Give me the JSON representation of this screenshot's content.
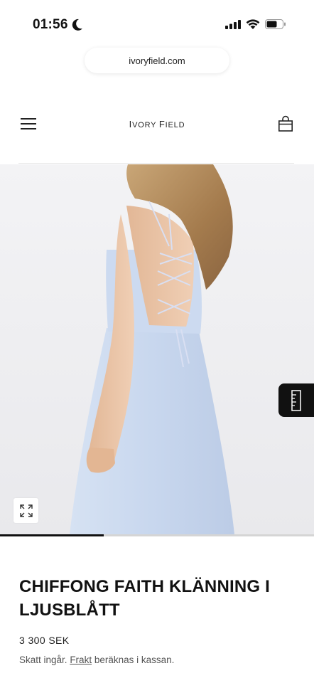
{
  "status_bar": {
    "time": "01:56",
    "icons": [
      "moon-icon",
      "signal-icon",
      "wifi-icon",
      "battery-icon"
    ]
  },
  "browser": {
    "url": "ivoryfield.com"
  },
  "header": {
    "brand_first_letter_1": "I",
    "brand_rest_1": "vory",
    "brand_first_letter_2": "F",
    "brand_rest_2": "ield",
    "icons": [
      "hamburger-menu-icon",
      "shopping-bag-icon"
    ]
  },
  "gallery": {
    "image_description": "product-photo",
    "expand_icon": "expand-icon",
    "size_guide_icon": "ruler-icon",
    "progress_fraction": 0.33
  },
  "product": {
    "title": "CHIFFONG FAITH KLÄNNING I LJUSBLÅTT",
    "price": "3 300 SEK",
    "tax_prefix": "Skatt ingår.",
    "shipping_link": "Frakt",
    "tax_suffix": "beräknas i kassan."
  },
  "colors": {
    "dress": "#cfdcf0",
    "hair": "#b08a5c",
    "skin": "#e8c2a4",
    "background": "#efeff2"
  }
}
